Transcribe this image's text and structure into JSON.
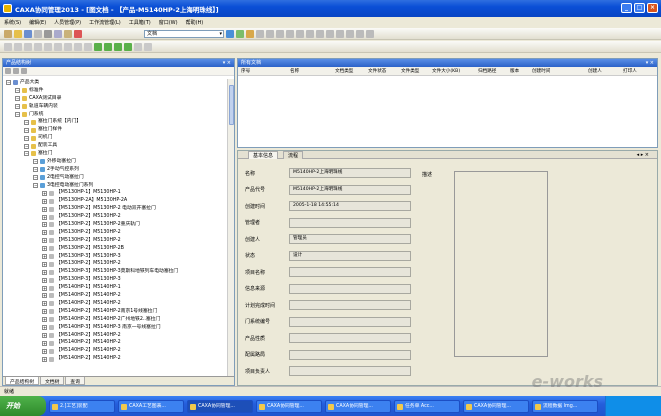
{
  "window": {
    "title": "CAXA协同管理2013 - [图文档 - 【产品-M5140HP-2上海明珠线】]"
  },
  "menu": [
    "系统(S)",
    "编辑(E)",
    "人员管理(P)",
    "工作流管理(L)",
    "工具箱(T)",
    "窗口(W)",
    "帮助(H)"
  ],
  "toolbar": {
    "combo_value": "文档"
  },
  "left_pane": {
    "title": "产品结构树",
    "tabs": [
      "产品结构树",
      "文档树",
      "查询"
    ],
    "tree": [
      {
        "level": 0,
        "label": "产品大类"
      },
      {
        "level": 1,
        "label": "标准件"
      },
      {
        "level": 1,
        "label": "CAXA测试目录"
      },
      {
        "level": 1,
        "label": "轨道车辆内装"
      },
      {
        "level": 1,
        "label": "门系统"
      },
      {
        "level": 2,
        "label": "塞拉门系统【内门】"
      },
      {
        "level": 2,
        "label": "塞拉门样件"
      },
      {
        "level": 2,
        "label": "司机门"
      },
      {
        "level": 2,
        "label": "配装工具"
      },
      {
        "level": 2,
        "label": "塞拉门"
      },
      {
        "level": 3,
        "label": "外移动塞拉门"
      },
      {
        "level": 3,
        "label": "2手动气控系列"
      },
      {
        "level": 3,
        "label": "2电控气动塞拉门"
      },
      {
        "level": 3,
        "label": "3电控电动塞拉门系列"
      },
      {
        "level": 4,
        "label": "【M5130HP-1】M5130HP-1"
      },
      {
        "level": 4,
        "label": "【M5130HP-2A】M5130HP-2A"
      },
      {
        "level": 4,
        "label": "【M5130HP-2】M5130HP-2 电动双开塞拉门"
      },
      {
        "level": 4,
        "label": "【M5130HP-2】M5130HP-2"
      },
      {
        "level": 4,
        "label": "【M5130HP-2】M5130HP-2重庆轨门"
      },
      {
        "level": 4,
        "label": "【M5130HP-2】M5130HP-2"
      },
      {
        "level": 4,
        "label": "【M5130HP-2】M5130HP-2"
      },
      {
        "level": 4,
        "label": "【M5130HP-2】M5130HP-2B"
      },
      {
        "level": 4,
        "label": "【M5130HP-3】M5130HP-3"
      },
      {
        "level": 4,
        "label": "【M5130HP-2】M5130HP-2"
      },
      {
        "level": 4,
        "label": "【M5130HP-3】M5130HP-3莫斯科地铁列车电动塞拉门"
      },
      {
        "level": 4,
        "label": "【M5130HP-3】M5130HP-3"
      },
      {
        "level": 4,
        "label": "【M5140HP-1】M5140HP-1"
      },
      {
        "level": 4,
        "label": "【M5140HP-2】M5140HP-2"
      },
      {
        "level": 4,
        "label": "【M5140HP-2】M5140HP-2"
      },
      {
        "level": 4,
        "label": "【M5140HP-2】M5140HP-2南京1号线塞拉门"
      },
      {
        "level": 4,
        "label": "【M5140HP-2】M5140HP-2广州地铁2..塞拉门"
      },
      {
        "level": 4,
        "label": "【M5140HP-3】M5140HP-3 南京一号线塞拉门"
      },
      {
        "level": 4,
        "label": "【M5140HP-2】M5140HP-2"
      },
      {
        "level": 4,
        "label": "【M5140HP-2】M5140HP-2"
      },
      {
        "level": 4,
        "label": "【M5140HP-2】M5140HP-2"
      },
      {
        "level": 4,
        "label": "【M5140HP-2】M5140HP-2"
      }
    ]
  },
  "doc_list": {
    "title": "所有文档",
    "columns": [
      "序号",
      "名称",
      "文档类型",
      "文件状态",
      "文件类型",
      "文件大小(KB)",
      "归档路径",
      "版本",
      "创建时间",
      "创建人",
      "打印人"
    ]
  },
  "detail": {
    "tabs": [
      "基本信息",
      "流程"
    ],
    "fields": [
      {
        "label": "名称",
        "value": "M5140HP-2上海明珠线"
      },
      {
        "label": "产品代号",
        "value": "M5140HP-2上海明珠线"
      },
      {
        "label": "创建时间",
        "value": "2005-1-18 14:55:14"
      },
      {
        "label": "管理者",
        "value": ""
      },
      {
        "label": "创建人",
        "value": "管理员"
      },
      {
        "label": "状态",
        "value": "设计"
      },
      {
        "label": "项目名称",
        "value": ""
      },
      {
        "label": "信息来源",
        "value": ""
      },
      {
        "label": "计划完成时间",
        "value": ""
      },
      {
        "label": "门系统编号",
        "value": ""
      },
      {
        "label": "产品性质",
        "value": ""
      },
      {
        "label": "配属路局",
        "value": ""
      },
      {
        "label": "项目负责人",
        "value": ""
      }
    ],
    "desc_label": "描述"
  },
  "statusbar": {
    "text": "就绪"
  },
  "taskbar": {
    "start": "开始",
    "buttons": [
      "2.[工艺]装配",
      "CAXA工艺图表...",
      "CAXA协同管理...",
      "CAXA协同管理...",
      "CAXA协同管理...",
      "任务单 Acc...",
      "CAXA协同管理...",
      "流程数据 lmg..."
    ],
    "tray_time": ""
  },
  "watermark": "e-works"
}
